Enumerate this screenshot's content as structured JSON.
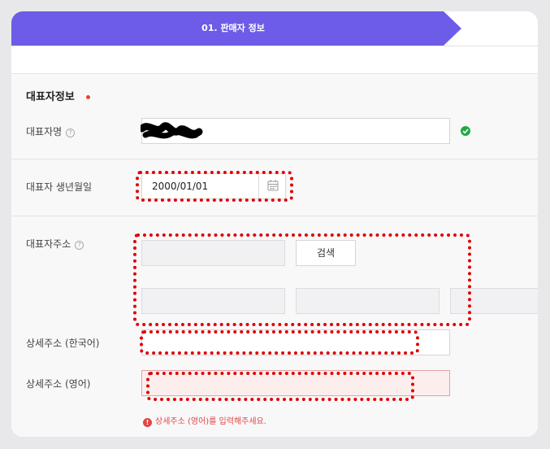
{
  "step": {
    "label": "01. 판매자 정보"
  },
  "section": {
    "title": "대표자정보"
  },
  "fields": {
    "rep_name": {
      "label": "대표자명",
      "help": "?"
    },
    "birth": {
      "label": "대표자 생년월일",
      "value": "2000/01/01"
    },
    "address": {
      "label": "대표자주소",
      "help": "?",
      "search_button": "검색"
    },
    "detail_ko": {
      "label": "상세주소 (한국어)"
    },
    "detail_en": {
      "label": "상세주소 (영어)",
      "error": "상세주소 (영어)를 입력해주세요.",
      "error_icon": "!"
    }
  },
  "icons": {
    "valid": "check-circle-icon",
    "calendar": "calendar-icon",
    "error": "exclamation-circle-icon"
  },
  "colors": {
    "accent": "#6c5ce7",
    "success": "#22a845",
    "error": "#e04646",
    "annotation": "#e00000"
  }
}
